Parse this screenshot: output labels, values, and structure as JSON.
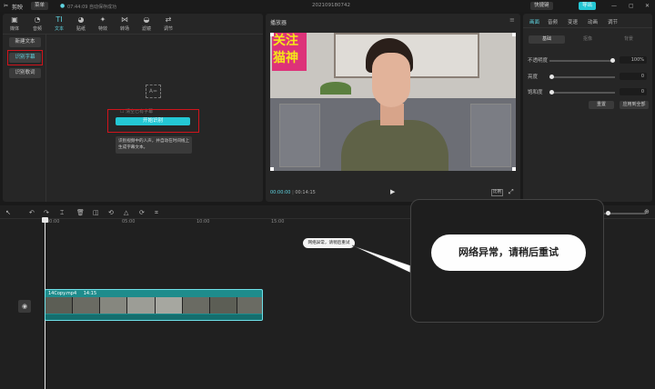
{
  "titlebar": {
    "app_name": "剪映",
    "menu_label": "菜单",
    "autosave": "07:44:09 自动保存成功",
    "project_name": "202109180742",
    "shortcut_label": "快捷键",
    "export_label": "导出"
  },
  "media_tools": [
    {
      "label": "媒体",
      "icon": "media-icon",
      "glyph": "▣"
    },
    {
      "label": "音频",
      "icon": "audio-icon",
      "glyph": "◔"
    },
    {
      "label": "文本",
      "icon": "text-icon",
      "glyph": "TI"
    },
    {
      "label": "贴纸",
      "icon": "sticker-icon",
      "glyph": "◕"
    },
    {
      "label": "特效",
      "icon": "effects-icon",
      "glyph": "✦"
    },
    {
      "label": "转场",
      "icon": "transition-icon",
      "glyph": "⋈"
    },
    {
      "label": "滤镜",
      "icon": "filter-icon",
      "glyph": "◒"
    },
    {
      "label": "调节",
      "icon": "adjust-icon",
      "glyph": "⇄"
    }
  ],
  "text_menu": {
    "new_text": "新建文本",
    "recognize_subtitle": "识别字幕",
    "recognize_lyrics": "识别歌词"
  },
  "recognize": {
    "option_label": "清空已有字幕",
    "start_button": "开始识别",
    "tooltip_line1": "识别视频中的人声，并自动在时间线上",
    "tooltip_line2": "生成字幕文本。"
  },
  "player": {
    "title": "播放器",
    "overlay_line1": "关注",
    "overlay_line2": "猫神",
    "time_current": "00:00:00",
    "time_total": "00:14:15",
    "ratio_label": "比例"
  },
  "properties": {
    "tabs": [
      "画面",
      "音频",
      "变速",
      "动画",
      "调节"
    ],
    "subtabs": [
      "基础",
      "抠像",
      "背景"
    ],
    "rows": [
      {
        "label": "不透明度",
        "value": "100%",
        "level": 1.0
      },
      {
        "label": "亮度",
        "value": "0",
        "level": 0.0
      },
      {
        "label": "饱和度",
        "value": "0",
        "level": 0.0
      }
    ],
    "reset_label": "重置",
    "apply_all_label": "应用到全部"
  },
  "timeline": {
    "ticks": [
      "00:00",
      "05:00",
      "10:00",
      "15:00"
    ],
    "error_small": "网络异常，请稍后重试",
    "error_large": "网络异常，请稍后重试",
    "clip_name": "14Copy.mp4",
    "clip_duration": "14:15"
  },
  "colors": {
    "accent": "#24c7d4",
    "highlight_red": "#d0141c",
    "overlay_yellow": "#f4e51a",
    "overlay_pink": "#e0186c",
    "clip_teal": "#1e8c8c"
  }
}
